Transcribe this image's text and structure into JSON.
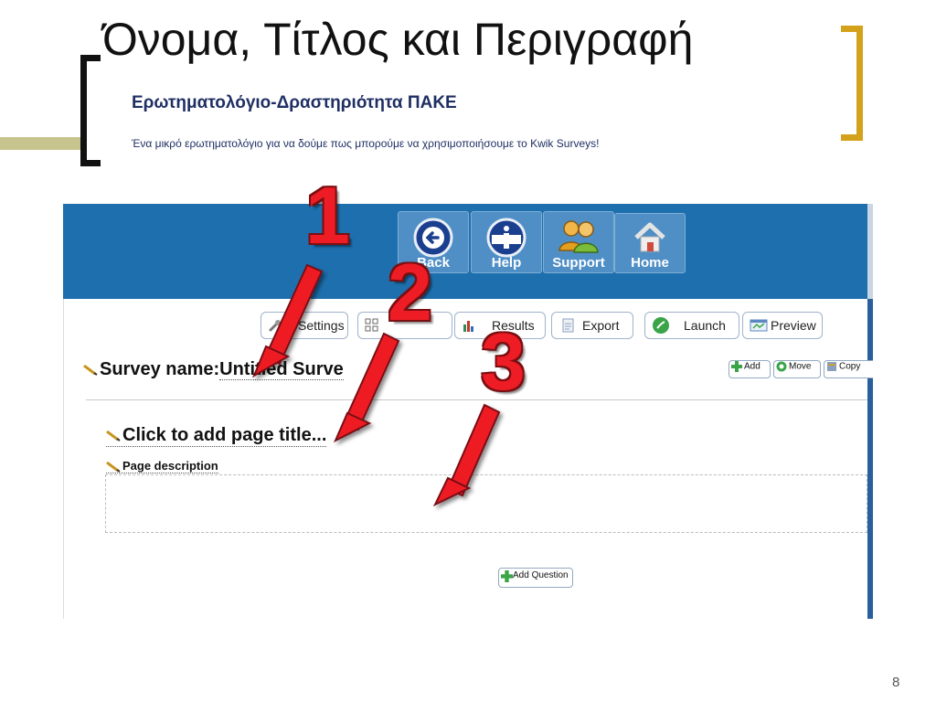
{
  "slide": {
    "title": "Όνομα, Τίτλος και Περιγραφή",
    "survey_heading": "Ερωτηματολόγιο-Δραστηριότητα ΠΑΚΕ",
    "survey_description": "Ένα μικρό ερωτηματολόγιο για να δούμε πως μπορούμε να χρησιμοποιήσουμε το Kwik Surveys!",
    "page_number": "8",
    "accent_colors": {
      "left_bar": "#c8c48e",
      "right_bracket": "#d4a21a"
    }
  },
  "header": {
    "background": "#1e6fad",
    "nav": [
      {
        "label": "Back",
        "icon": "back-arrow-icon"
      },
      {
        "label": "Help",
        "icon": "info-icon"
      },
      {
        "label": "Support",
        "icon": "people-icon"
      },
      {
        "label": "Home",
        "icon": "house-icon"
      }
    ]
  },
  "toolbar": {
    "items": [
      {
        "label": "Settings",
        "icon": "wrench-icon"
      },
      {
        "label": "",
        "icon": "grid-icon"
      },
      {
        "label": "Results",
        "icon": "bar-chart-icon"
      },
      {
        "label": "Export",
        "icon": "export-icon"
      },
      {
        "label": "Launch",
        "icon": "launch-icon"
      },
      {
        "label": "Preview",
        "icon": "preview-icon"
      }
    ]
  },
  "survey": {
    "name_label": "Survey name:",
    "name_value": "Untitled Surve",
    "actions": [
      {
        "label": "Add",
        "icon": "plus-icon"
      },
      {
        "label": "Move",
        "icon": "move-icon"
      },
      {
        "label": "Copy",
        "icon": "copy-icon"
      }
    ]
  },
  "page": {
    "title": "Click to add page title...",
    "description_label": "Page description",
    "add_question_label": "Add Question"
  },
  "annotations": {
    "numbers": [
      "1",
      "2",
      "3"
    ],
    "color": "#ee1c24"
  }
}
